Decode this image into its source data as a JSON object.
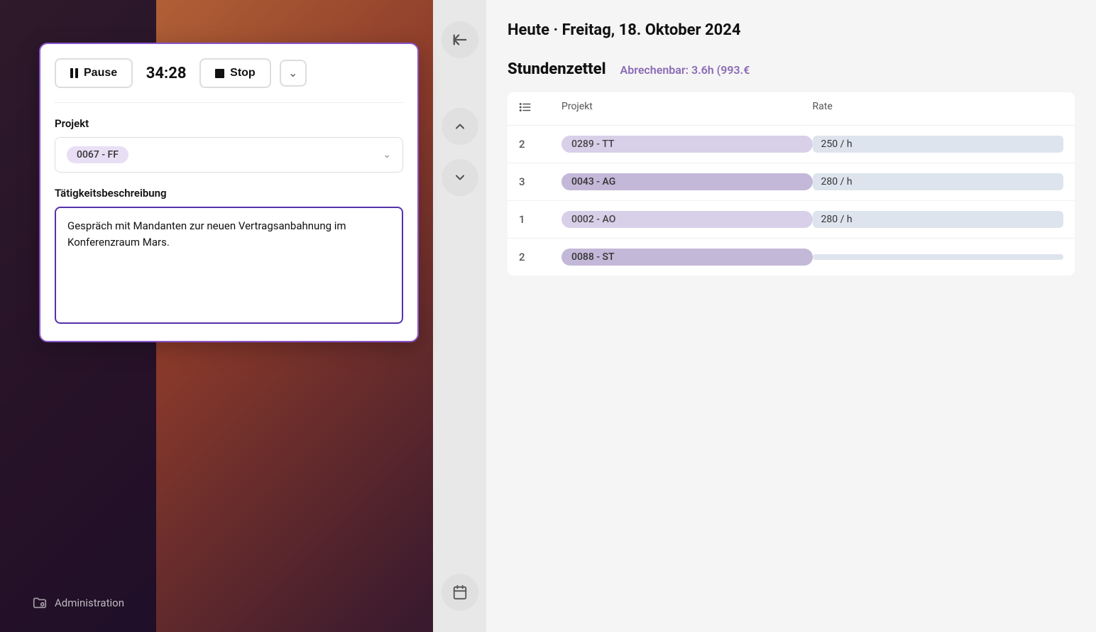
{
  "background": {
    "gradient": "linear-gradient(135deg, #c0703a 0%, #8b3a2a 30%, #3a1a2e 60%, #1a0a2e 100%)"
  },
  "sidebar": {
    "admin_label": "Administration",
    "admin_icon": "folder-gear"
  },
  "timer": {
    "pause_label": "Pause",
    "stop_label": "Stop",
    "time_display": "34:28",
    "chevron_icon": "chevron-down"
  },
  "form": {
    "project_label": "Projekt",
    "project_value": "0067 - FF",
    "description_label": "Tätigkeitsbeschreibung",
    "description_text": "Gespräch mit Mandanten zur neuen Vertragsanbahnung im Konferenzraum Mars."
  },
  "header": {
    "today_label": "Heute",
    "separator": "·",
    "date": "Freitag, 18. Oktober 2024"
  },
  "stundenzettel": {
    "title": "Stundenzettel",
    "billable_label": "Abrechenbar: 3.6h (993.€"
  },
  "table": {
    "columns": [
      {
        "icon": "list-icon",
        "label": ""
      },
      {
        "label": "Projekt"
      },
      {
        "label": "Rate"
      }
    ],
    "rows": [
      {
        "num": "2",
        "project": "0289 - TT",
        "rate": "250 / h",
        "badge_class": "light"
      },
      {
        "num": "3",
        "project": "0043 - AG",
        "rate": "280 / h",
        "badge_class": "medium"
      },
      {
        "num": "1",
        "project": "0002 - AO",
        "rate": "280 / h",
        "badge_class": "light"
      },
      {
        "num": "2",
        "project": "0088 - ST",
        "rate": "",
        "badge_class": "medium"
      }
    ]
  },
  "nav": {
    "back_icon": "arrow-left",
    "up_icon": "chevron-up",
    "down_icon": "chevron-down",
    "calendar_icon": "calendar"
  }
}
